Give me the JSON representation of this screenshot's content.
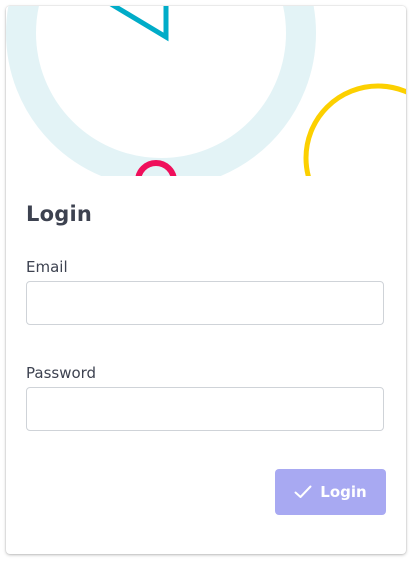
{
  "card": {
    "title": "Login"
  },
  "form": {
    "email_label": "Email",
    "email_value": "",
    "password_label": "Password",
    "password_value": "",
    "submit_label": "Login",
    "submit_icon": "check-icon"
  },
  "theme": {
    "title_color": "#3d4250",
    "button_color": "#a8a9f2",
    "banner_circle_light": "#e3f3f6",
    "banner_triangle": "#00acc8",
    "banner_ring_pink": "#ef0f5b",
    "banner_ring_yellow": "#fcd000"
  }
}
